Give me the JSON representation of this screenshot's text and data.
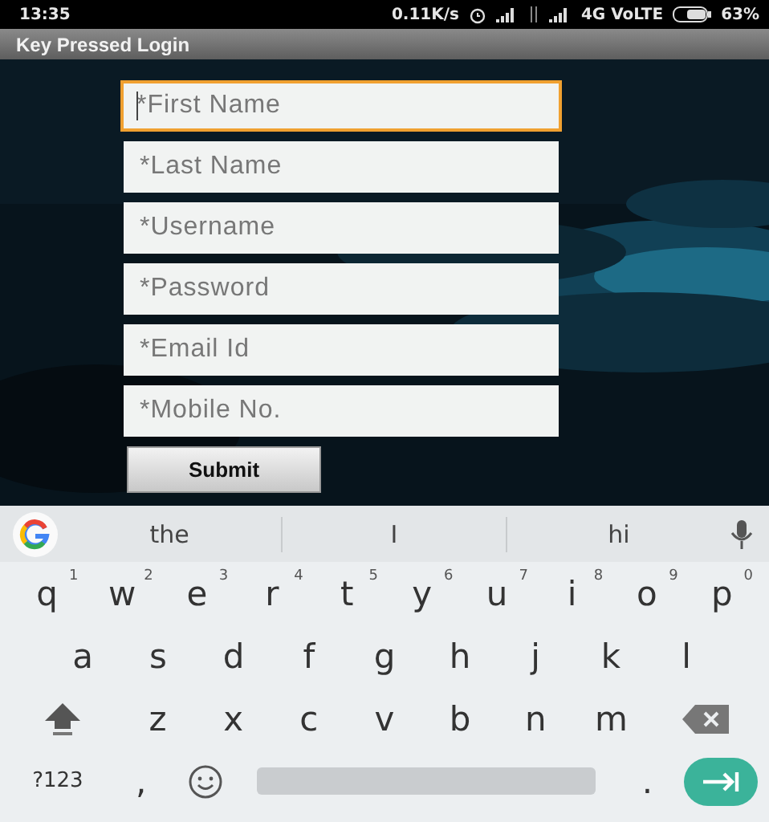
{
  "status_bar": {
    "time": "13:35",
    "speed": "0.11K/s",
    "network": "4G VoLTE",
    "battery": "63%"
  },
  "title_bar": {
    "title": "Key Pressed Login"
  },
  "form": {
    "fields": [
      {
        "placeholder": "*First Name",
        "focused": true
      },
      {
        "placeholder": "*Last Name",
        "focused": false
      },
      {
        "placeholder": "*Username",
        "focused": false
      },
      {
        "placeholder": "*Password",
        "focused": false
      },
      {
        "placeholder": "*Email Id",
        "focused": false
      },
      {
        "placeholder": "*Mobile No.",
        "focused": false
      }
    ],
    "submit": "Submit"
  },
  "keyboard": {
    "suggestions": [
      "the",
      "I",
      "hi"
    ],
    "rows": [
      [
        {
          "kind": "letter",
          "label": "q",
          "hint": "1"
        },
        {
          "kind": "letter",
          "label": "w",
          "hint": "2"
        },
        {
          "kind": "letter",
          "label": "e",
          "hint": "3"
        },
        {
          "kind": "letter",
          "label": "r",
          "hint": "4"
        },
        {
          "kind": "letter",
          "label": "t",
          "hint": "5"
        },
        {
          "kind": "letter",
          "label": "y",
          "hint": "6"
        },
        {
          "kind": "letter",
          "label": "u",
          "hint": "7"
        },
        {
          "kind": "letter",
          "label": "i",
          "hint": "8"
        },
        {
          "kind": "letter",
          "label": "o",
          "hint": "9"
        },
        {
          "kind": "letter",
          "label": "p",
          "hint": "0"
        }
      ],
      [
        {
          "kind": "letter",
          "label": "a"
        },
        {
          "kind": "letter",
          "label": "s"
        },
        {
          "kind": "letter",
          "label": "d"
        },
        {
          "kind": "letter",
          "label": "f"
        },
        {
          "kind": "letter",
          "label": "g"
        },
        {
          "kind": "letter",
          "label": "h"
        },
        {
          "kind": "letter",
          "label": "j"
        },
        {
          "kind": "letter",
          "label": "k"
        },
        {
          "kind": "letter",
          "label": "l"
        }
      ],
      [
        {
          "kind": "shift"
        },
        {
          "kind": "letter",
          "label": "z"
        },
        {
          "kind": "letter",
          "label": "x"
        },
        {
          "kind": "letter",
          "label": "c"
        },
        {
          "kind": "letter",
          "label": "v"
        },
        {
          "kind": "letter",
          "label": "b"
        },
        {
          "kind": "letter",
          "label": "n"
        },
        {
          "kind": "letter",
          "label": "m"
        },
        {
          "kind": "backspace"
        }
      ],
      [
        {
          "kind": "symbols",
          "label": "?123"
        },
        {
          "kind": "letter",
          "label": ","
        },
        {
          "kind": "emoji"
        },
        {
          "kind": "space"
        },
        {
          "kind": "letter",
          "label": "."
        },
        {
          "kind": "enter"
        }
      ]
    ]
  }
}
